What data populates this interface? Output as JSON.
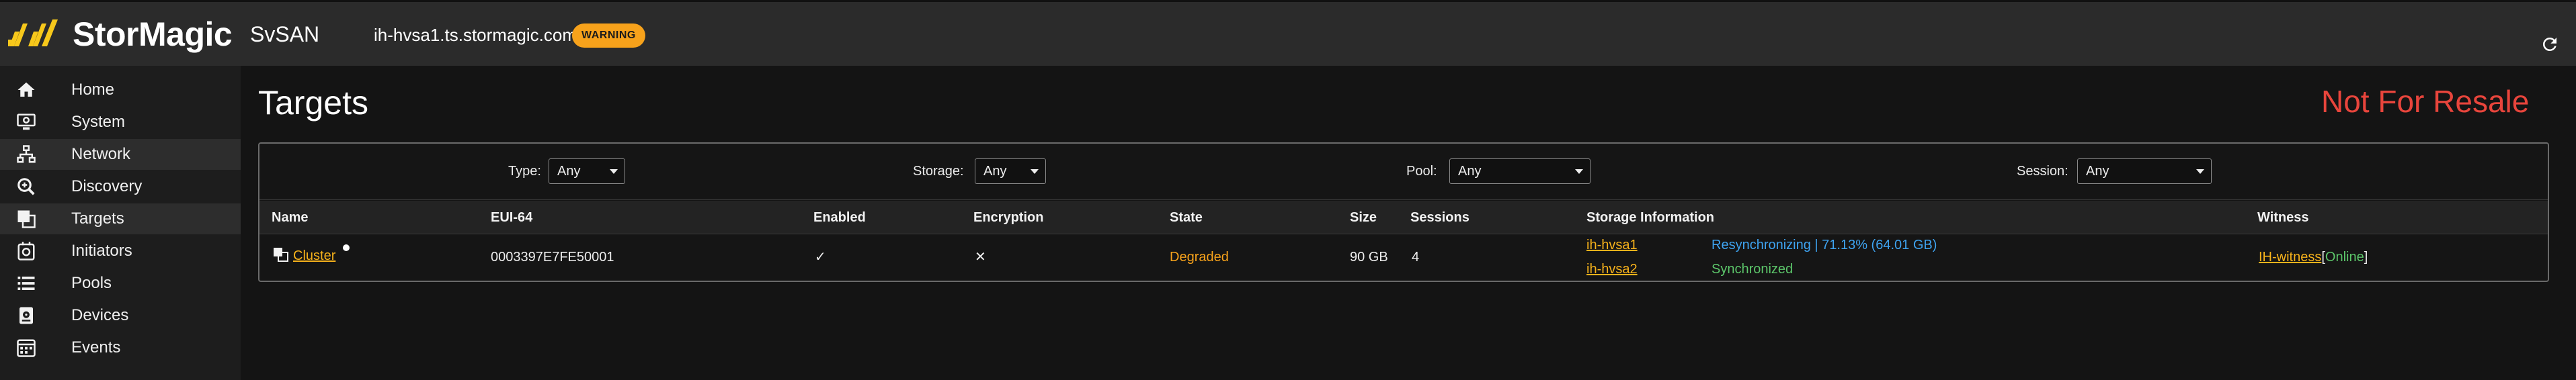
{
  "header": {
    "brand": "StorMagic",
    "product": "SvSAN",
    "host": "ih-hvsa1.ts.stormagic.com",
    "badge": "WARNING",
    "accent_color": "#f7c81b",
    "badge_color": "#f7a21b",
    "refresh_icon": "refresh-icon"
  },
  "sidebar": {
    "items": [
      {
        "label": "Home",
        "icon": "home-icon"
      },
      {
        "label": "System",
        "icon": "system-icon"
      },
      {
        "label": "Network",
        "icon": "network-icon",
        "active": true
      },
      {
        "label": "Discovery",
        "icon": "discovery-icon"
      },
      {
        "label": "Targets",
        "icon": "targets-icon",
        "active": true
      },
      {
        "label": "Initiators",
        "icon": "initiators-icon"
      },
      {
        "label": "Pools",
        "icon": "pools-icon"
      },
      {
        "label": "Devices",
        "icon": "devices-icon"
      },
      {
        "label": "Events",
        "icon": "events-icon"
      }
    ]
  },
  "main": {
    "title": "Targets",
    "resale_notice": "Not For Resale",
    "resale_color": "#e8453c"
  },
  "filters": {
    "type": {
      "label": "Type:",
      "value": "Any"
    },
    "storage": {
      "label": "Storage:",
      "value": "Any"
    },
    "pool": {
      "label": "Pool:",
      "value": "Any"
    },
    "session": {
      "label": "Session:",
      "value": "Any"
    }
  },
  "table": {
    "columns": [
      "Name",
      "EUI-64",
      "Enabled",
      "Encryption",
      "State",
      "Size",
      "Sessions",
      "Storage Information",
      "Witness"
    ],
    "rows": [
      {
        "name": "Cluster",
        "eui64": "0003397E7FE50001",
        "enabled": "✓",
        "encryption": "✕",
        "state": "Degraded",
        "size": "90 GB",
        "sessions": "4",
        "storage": [
          {
            "host": "ih-hvsa1",
            "status": "Resynchronizing | 71.13% (64.01 GB)"
          },
          {
            "host": "ih-hvsa2",
            "status": "Synchronized"
          }
        ],
        "witness": {
          "name": "IH-witness",
          "open": "[",
          "status": "Online",
          "close": "]"
        }
      }
    ]
  }
}
